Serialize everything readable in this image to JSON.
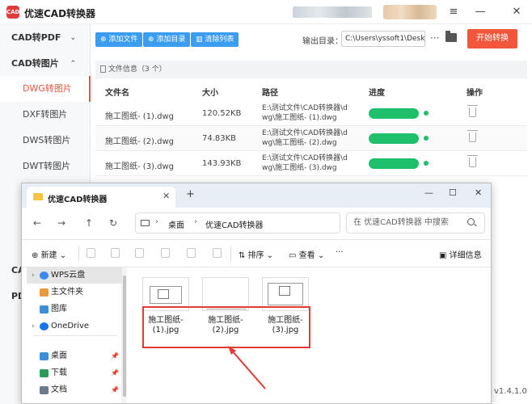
{
  "app": {
    "logo_text": "CAD",
    "title": "优速CAD转换器",
    "window": {
      "menu_icon": "≡",
      "minimize_icon": "—",
      "close_icon": "✕"
    }
  },
  "sidebar": {
    "groups": [
      {
        "label": "CAD转PDF",
        "chevron": "⌄"
      },
      {
        "label": "CAD转图片",
        "chevron": "⌃"
      }
    ],
    "items": [
      {
        "label": "DWG转图片",
        "active": true
      },
      {
        "label": "DXF转图片",
        "active": false
      },
      {
        "label": "DWS转图片",
        "active": false
      },
      {
        "label": "DWT转图片",
        "active": false
      }
    ],
    "partial_groups": [
      "CAD",
      "PD"
    ]
  },
  "toolbar": {
    "add_file": "添加文件",
    "add_folder": "添加目录",
    "clear_list": "清除列表",
    "output_label": "输出目录：",
    "output_path": "C:\\Users\\yssoft1\\Deskt",
    "more_icon": "···",
    "start": "开始转换"
  },
  "file_info": "文件信息（3 个）",
  "table": {
    "headers": [
      "文件名",
      "大小",
      "路径",
      "进度",
      "操作"
    ],
    "rows": [
      {
        "name": "施工图纸- (1).dwg",
        "size": "120.52KB",
        "path1": "E:\\测试文件\\CAD转换器\\d",
        "path2": "wg\\施工图纸- (1).dwg",
        "progress": 1.0
      },
      {
        "name": "施工图纸- (2).dwg",
        "size": "74.83KB",
        "path1": "E:\\测试文件\\CAD转换器\\d",
        "path2": "wg\\施工图纸- (2).dwg",
        "progress": 1.0
      },
      {
        "name": "施工图纸- (3).dwg",
        "size": "143.93KB",
        "path1": "E:\\测试文件\\CAD转换器\\d",
        "path2": "wg\\施工图纸- (3).dwg",
        "progress": 1.0
      }
    ]
  },
  "version": "v1.4.1.0",
  "explorer": {
    "tab_title": "优速CAD转换器",
    "tab_close": "✕",
    "tab_add": "+",
    "window": {
      "minimize": "—",
      "maximize": "☐",
      "close": "✕"
    },
    "nav": {
      "back": "←",
      "forward": "→",
      "up": "↑",
      "refresh": "↻"
    },
    "breadcrumb": [
      "桌面",
      "优速CAD转换器"
    ],
    "crumb_sep": "›",
    "search_placeholder": "在 优速CAD转换器 中搜索",
    "commands": {
      "new": "新建",
      "sort": "排序",
      "view": "查看",
      "more": "···",
      "details": "详细信息"
    },
    "nav_pane": {
      "top": [
        {
          "label": "WPS云盘",
          "selected": true
        },
        {
          "label": "主文件夹",
          "selected": false
        },
        {
          "label": "图库",
          "selected": false
        },
        {
          "label": "OneDrive",
          "selected": false
        }
      ],
      "quick": [
        {
          "label": "桌面"
        },
        {
          "label": "下载"
        },
        {
          "label": "文档"
        }
      ]
    },
    "files": [
      {
        "line1": "施工图纸-",
        "line2": "(1).jpg"
      },
      {
        "line1": "施工图纸-",
        "line2": "(2).jpg"
      },
      {
        "line1": "施工图纸-",
        "line2": "(3).jpg"
      }
    ]
  },
  "colors": {
    "accent": "#e8543d",
    "toolbar_blue": "#3a9df0",
    "progress_green": "#1ec06b",
    "highlight_red": "#e53935"
  }
}
